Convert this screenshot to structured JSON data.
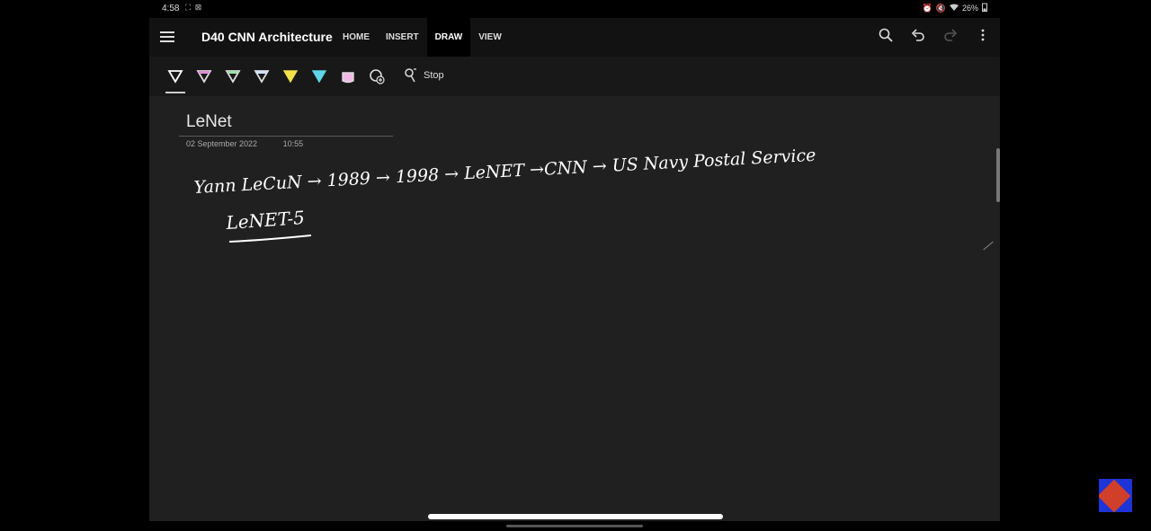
{
  "status_bar": {
    "time": "4:58",
    "indicators": "⛶ ⊠",
    "battery": "26%",
    "icons": [
      "alarm-icon",
      "mute-icon",
      "wifi-icon",
      "battery-icon"
    ]
  },
  "app": {
    "doc_title": "D40 CNN Architecture",
    "tabs": [
      {
        "label": "HOME",
        "active": false
      },
      {
        "label": "INSERT",
        "active": false
      },
      {
        "label": "DRAW",
        "active": true
      },
      {
        "label": "VIEW",
        "active": false
      }
    ],
    "actions": [
      {
        "name": "search-button",
        "icon": "search-icon",
        "enabled": true
      },
      {
        "name": "undo-button",
        "icon": "undo-icon",
        "enabled": true
      },
      {
        "name": "redo-button",
        "icon": "redo-icon",
        "enabled": false
      },
      {
        "name": "more-button",
        "icon": "more-vertical-icon",
        "enabled": true
      }
    ]
  },
  "draw_toolbar": {
    "pens": [
      {
        "name": "pen-white",
        "color": "#ffffff"
      },
      {
        "name": "pen-pink",
        "color": "#e08ad8"
      },
      {
        "name": "pen-green",
        "color": "#9ee0a8"
      },
      {
        "name": "pen-lightblue",
        "color": "#cfe2ff"
      },
      {
        "name": "highlighter-yellow",
        "color": "#f2e24a"
      },
      {
        "name": "highlighter-cyan",
        "color": "#5fd6e8"
      },
      {
        "name": "highlighter-pink",
        "color": "#f3b9e6"
      },
      {
        "name": "add-pen",
        "color": "#dddddd"
      }
    ],
    "stop_label": "Stop"
  },
  "page": {
    "title": "LeNet",
    "date": "02 September 2022",
    "time": "10:55",
    "ink_line1": "Yann LeCuN → 1989 → 1998 → LeNET →CNN → US Navy Postal Service",
    "ink_line2": "LeNET-5"
  },
  "colors": {
    "background": "#202020",
    "titlebar": "#121212",
    "toolbar": "#181818",
    "ink": "#ffffff"
  }
}
